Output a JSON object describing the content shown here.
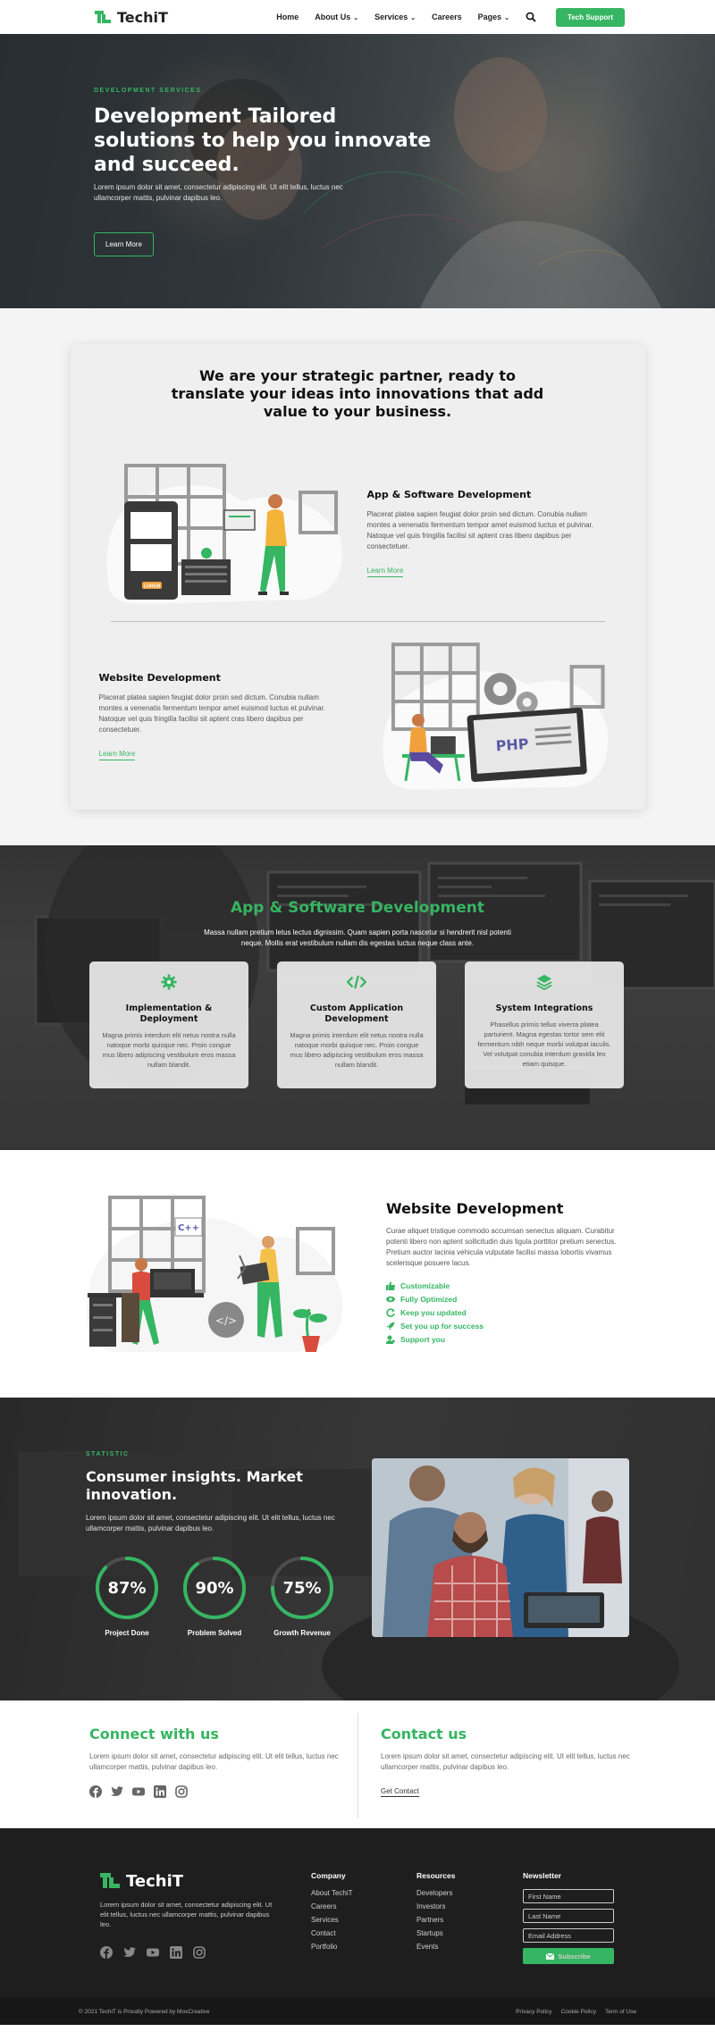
{
  "nav": {
    "logo": "TechiT",
    "items": [
      {
        "label": "Home",
        "has_chevron": false
      },
      {
        "label": "About Us",
        "has_chevron": true
      },
      {
        "label": "Services",
        "has_chevron": true
      },
      {
        "label": "Careers",
        "has_chevron": false
      },
      {
        "label": "Pages",
        "has_chevron": true
      }
    ],
    "cta": "Tech Support"
  },
  "hero": {
    "eyebrow": "DEVELOPMENT SERVICES",
    "title": "Development Tailored solutions to help you innovate and succeed.",
    "text": "Lorem ipsum dolor sit amet, consectetur adipiscing elit. Ut elit tellus, luctus nec ullamcorper mattis, pulvinar dapibus leo.",
    "button": "Learn More"
  },
  "partner": {
    "title": "We are your strategic partner, ready to translate your ideas into innovations that add value to your business.",
    "services": [
      {
        "title": "App & Software Development",
        "text": "Placerat platea sapien feugiat dolor proin sed dictum. Conubia nullam montes a venenatis fermentum tempor amet euismod luctus et pulvinar. Natoque vel quis fringilla facilisi sit aptent cras libero dapibus per consectetuer.",
        "link": "Learn More"
      },
      {
        "title": "Website Development",
        "text": "Placerat platea sapien feugiat dolor proin sed dictum. Conubia nullam montes a venenatis fermentum tempor amet euismod luctus et pulvinar. Natoque vel quis fringilla facilisi sit aptent cras libero dapibus per consectetuer.",
        "link": "Learn More",
        "illus_label": "PHP"
      }
    ],
    "illus_badge": "LOREM"
  },
  "app_dev": {
    "title": "App & Software Development",
    "subtitle": "Massa nullam pretium letus lectus dignissim. Quam sapien porta nascetur si hendrerit nisl potenti neque. Mollis erat vestibulum nullam dis egestas luctus neque class ante.",
    "cards": [
      {
        "icon": "gear-icon",
        "title": "Implementation & Deployment",
        "text": "Magna primis interdum elit netus nostra nulla natoque morbi quisque nec. Proin congue mus libero adipiscing vestibulum eros massa nullam blandit."
      },
      {
        "icon": "code-icon",
        "title": "Custom Application Development",
        "text": "Magna primis interdum elit netus nostra nulla natoque morbi quisque nec. Proin congue mus libero adipiscing vestibulum eros massa nullam blandit."
      },
      {
        "icon": "layers-icon",
        "title": "System Integrations",
        "text": "Phasellus primis tellus viverra platea parturient. Magna egestas tortor sem elit fermentum nibh neque morbi volutpat iaculis. Vel volutpat conubia interdum gravida leo etiam quisque."
      }
    ]
  },
  "web_dev": {
    "title": "Website Development",
    "text": "Curae aliquet tristique commodo accumsan senectus aliquam. Curabitur potenti libero non aptent sollicitudin duis ligula porttitor pretium senectus. Pretium auctor lacinia vehicula vulputate facilisi massa lobortis vivamus scelerisque posuere lacus.",
    "features": [
      {
        "icon": "thumbs-up-icon",
        "label": "Customizable"
      },
      {
        "icon": "eye-icon",
        "label": "Fully Optimized"
      },
      {
        "icon": "refresh-icon",
        "label": "Keep you updated"
      },
      {
        "icon": "rocket-icon",
        "label": "Set you up for success"
      },
      {
        "icon": "user-support-icon",
        "label": "Support you"
      }
    ],
    "illus_label": "C++"
  },
  "stats": {
    "eyebrow": "STATISTIC",
    "title": "Consumer insights. Market innovation.",
    "text": "Lorem ipsum dolor sit amet, consectetur adipiscing elit. Ut elit tellus, luctus nec ullamcorper mattis, pulvinar dapibus leo.",
    "items": [
      {
        "value": "87%",
        "percent": 87,
        "label": "Project Done"
      },
      {
        "value": "90%",
        "percent": 90,
        "label": "Problem Solved"
      },
      {
        "value": "75%",
        "percent": 75,
        "label": "Growth Revenue"
      }
    ]
  },
  "connect": {
    "title": "Connect with us",
    "text": "Lorem ipsum dolor sit amet, consectetur adipiscing elit. Ut elit tellus, luctus nec ullamcorper mattis, pulvinar dapibus leo."
  },
  "contact": {
    "title": "Contact us",
    "text": "Lorem ipsum dolor sit amet, consectetur adipiscing elit. Ut elit tellus, luctus nec ullamcorper mattis, pulvinar dapibus leo.",
    "link": "Get Contact"
  },
  "footer": {
    "logo": "TechiT",
    "text": "Lorem ipsum dolor sit amet, consectetur adipiscing elit. Ut elit tellus, luctus nec ullamcorper mattis, pulvinar dapibus leo.",
    "columns": [
      {
        "title": "Company",
        "links": [
          "About TechiT",
          "Careers",
          "Services",
          "Contact",
          "Portfolio"
        ]
      },
      {
        "title": "Resources",
        "links": [
          "Developers",
          "Investors",
          "Partners",
          "Startups",
          "Events"
        ]
      }
    ],
    "newsletter": {
      "title": "Newsletter",
      "first_name": "First Name",
      "last_name": "Last Name",
      "email": "Email Address",
      "button": "Subscribe"
    },
    "copyright": "© 2021 TechiT is Proudly Powered by MoxCreative",
    "bottom_links": [
      "Privacy Policy",
      "Cookie Policy",
      "Term of Use"
    ]
  },
  "colors": {
    "accent": "#36b562",
    "dark": "#1e1e1e"
  }
}
